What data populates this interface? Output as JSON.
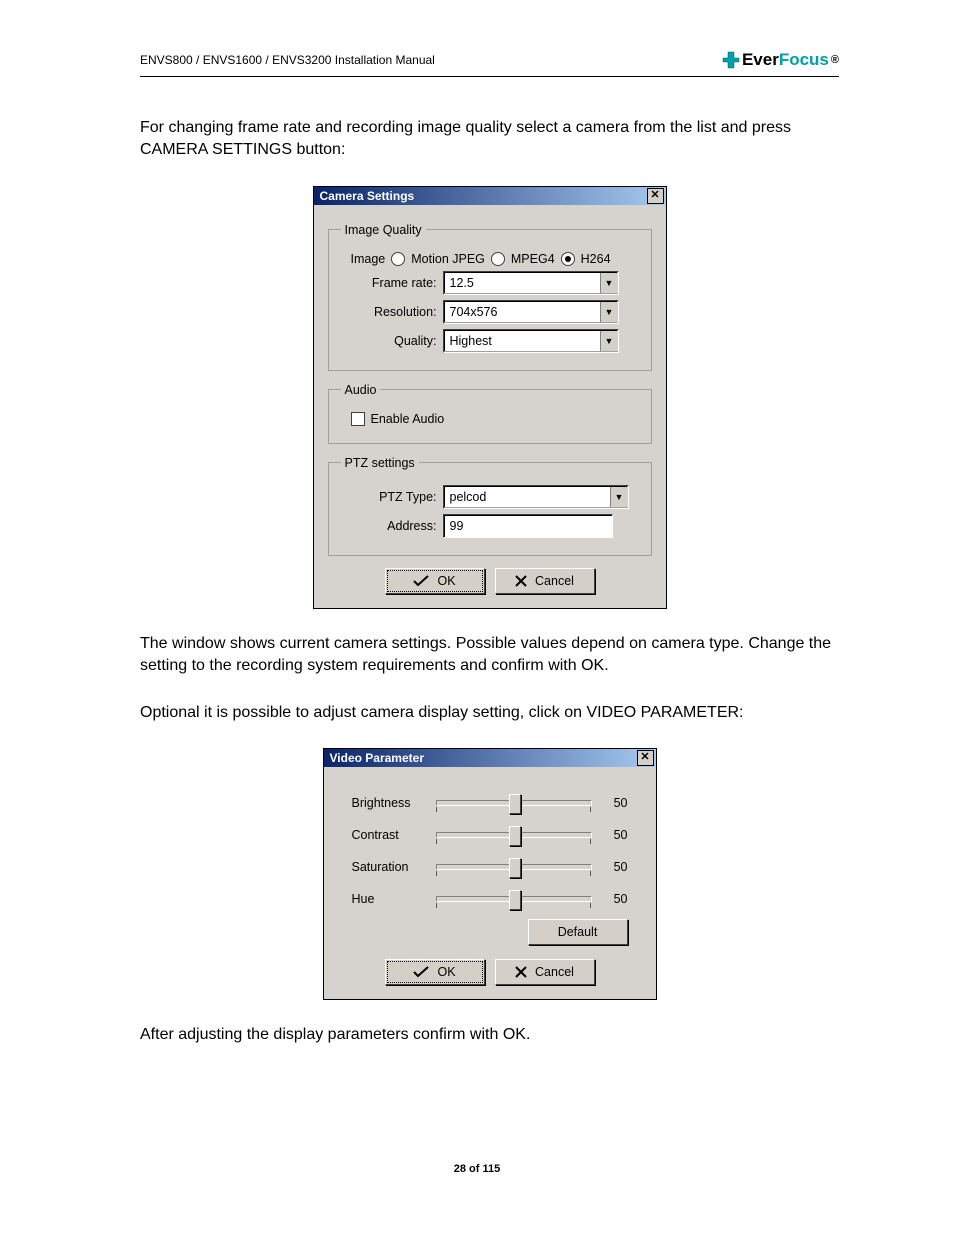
{
  "header": {
    "doc_title": "ENVS800 / ENVS1600 / ENVS3200 Installation Manual",
    "brand_prefix": "Ever",
    "brand_suffix": "Focus",
    "brand_reg": "®"
  },
  "paragraphs": {
    "p1": "For changing frame rate and recording  image quality select a camera from the list and  press CAMERA SETTINGS button:",
    "p2": "The window shows current camera settings. Possible values depend on camera type. Change the setting to the recording system requirements and confirm with  OK.",
    "p3": "Optional it is possible to adjust camera display setting, click on VIDEO PARAMETER:",
    "p4": "After adjusting the display parameters confirm with OK."
  },
  "dialog_cs": {
    "title": "Camera Settings",
    "group_image_quality": "Image Quality",
    "radio_label_prefix": "Image",
    "radios": {
      "mjpeg": "Motion JPEG",
      "mpeg4": "MPEG4",
      "h264": "H264"
    },
    "framerate_label": "Frame rate:",
    "framerate_value": "12.5",
    "resolution_label": "Resolution:",
    "resolution_value": "704x576",
    "quality_label": "Quality:",
    "quality_value": "Highest",
    "group_audio": "Audio",
    "enable_audio": "Enable Audio",
    "group_ptz": "PTZ settings",
    "ptz_type_label": "PTZ Type:",
    "ptz_type_value": "pelcod",
    "address_label": "Address:",
    "address_value": "99",
    "ok": "OK",
    "cancel": "Cancel"
  },
  "dialog_vp": {
    "title": "Video Parameter",
    "sliders": [
      {
        "label": "Brightness",
        "value": "50"
      },
      {
        "label": "Contrast",
        "value": "50"
      },
      {
        "label": "Saturation",
        "value": "50"
      },
      {
        "label": "Hue",
        "value": "50"
      }
    ],
    "default": "Default",
    "ok": "OK",
    "cancel": "Cancel"
  },
  "footer": {
    "page": "28 of 115"
  }
}
